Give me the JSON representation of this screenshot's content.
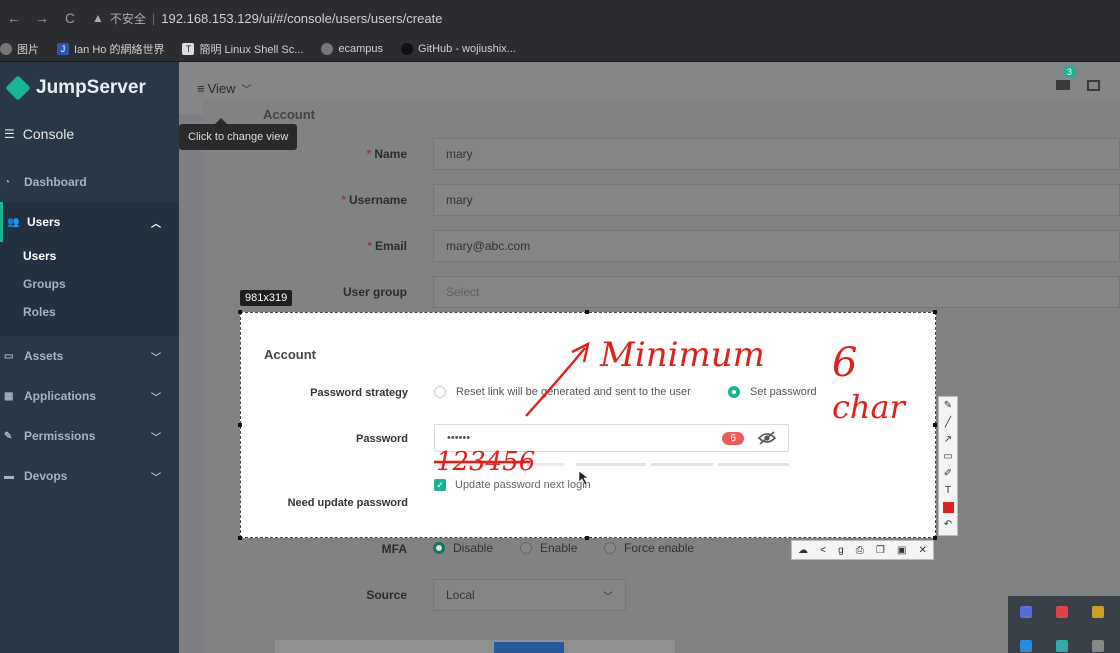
{
  "browser": {
    "back": "←",
    "forward": "→",
    "reload": "C",
    "security_label": "不安全",
    "url": "192.168.153.129/ui/#/console/users/users/create"
  },
  "bookmarks": [
    {
      "label": "图片"
    },
    {
      "label": "Ian Ho 的網絡世界"
    },
    {
      "label": "簡明 Linux Shell Sc..."
    },
    {
      "label": "ecampus"
    },
    {
      "label": "GitHub - wojiushix..."
    }
  ],
  "sidebar": {
    "brand": "JumpServer",
    "console": "Console",
    "items": [
      {
        "label": "Dashboard"
      },
      {
        "label": "Users"
      },
      {
        "label": "Assets"
      },
      {
        "label": "Applications"
      },
      {
        "label": "Permissions"
      },
      {
        "label": "Devops"
      }
    ],
    "sub_items": [
      {
        "label": "Users"
      },
      {
        "label": "Groups"
      },
      {
        "label": "Roles"
      }
    ]
  },
  "topbar": {
    "view_label": "View",
    "tooltip": "Click to change view",
    "notification_count": "3"
  },
  "form": {
    "section_title": "Account",
    "name_label": "Name",
    "name_value": "mary",
    "username_label": "Username",
    "username_value": "mary",
    "email_label": "Email",
    "email_value": "mary@abc.com",
    "group_label": "User group",
    "group_placeholder": "Select",
    "mfa_label": "MFA",
    "mfa_options": [
      "Disable",
      "Enable",
      "Force enable"
    ],
    "source_label": "Source",
    "source_value": "Local"
  },
  "capture": {
    "size": "981x319",
    "section_title": "Account",
    "strategy_label": "Password strategy",
    "strategy_option_reset": "Reset link will be generated and sent to the user",
    "strategy_option_set": "Set password",
    "password_label": "Password",
    "password_value": "••••••",
    "password_length": "6",
    "update_check_label": "Update password next login",
    "need_update_label": "Need update password"
  },
  "annotations": {
    "handwriting_1": "Minimum",
    "handwriting_2": "6",
    "handwriting_3": "char",
    "handwriting_4": "123456",
    "ink_color": "#e0201c"
  },
  "colors": {
    "accent": "#1ab394",
    "sidebar": "#293846"
  }
}
